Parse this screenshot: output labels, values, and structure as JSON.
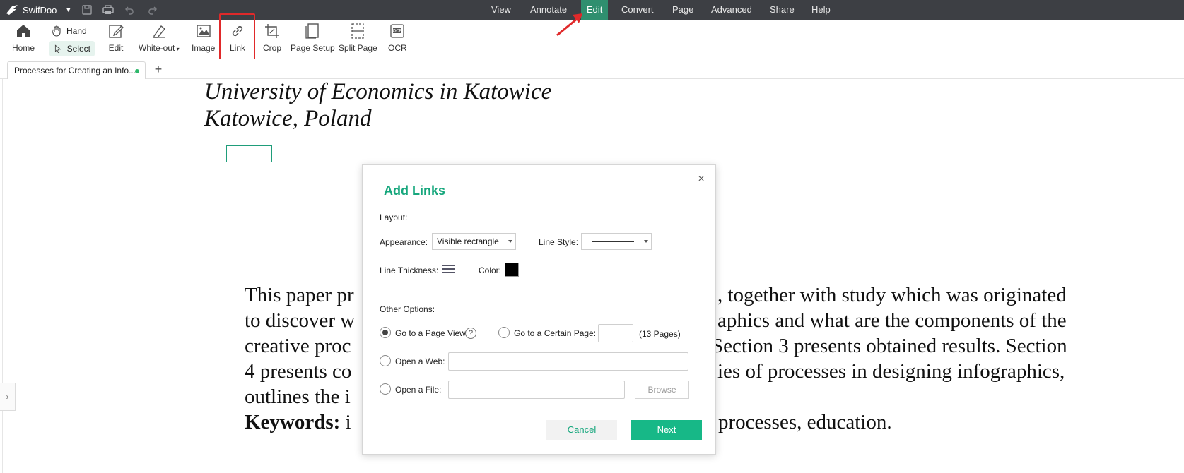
{
  "app": {
    "name": "SwifDoo"
  },
  "menu": {
    "items": [
      "View",
      "Annotate",
      "Edit",
      "Convert",
      "Page",
      "Advanced",
      "Share",
      "Help"
    ],
    "active": "Edit"
  },
  "toolbar": {
    "home": "Home",
    "hand": "Hand",
    "select": "Select",
    "edit": "Edit",
    "whiteout": "White-out",
    "image": "Image",
    "link": "Link",
    "crop": "Crop",
    "page_setup": "Page Setup",
    "split_page": "Split Page",
    "ocr": "OCR"
  },
  "tabs": {
    "doc_tab": "Processes for Creating an Info...",
    "add": "+"
  },
  "document": {
    "line1": "University of Economics in Katowice",
    "line2": "Katowice, Poland",
    "para": {
      "l1a": "This paper pr",
      "l1b": ", together with study which was originated",
      "l2a": "to discover w",
      "l2b": "aphics and what are the components of the",
      "l3a": "creative proc",
      "l3b": "Section 3 presents obtained results. Section",
      "l4a": "4 presents co",
      "l4b": "ies of processes in designing infographics,",
      "l5a": "outlines the i",
      "kw_label": "Keywords:",
      "kw_a": " i",
      "kw_b": "processes, education."
    }
  },
  "dialog": {
    "title": "Add Links",
    "close": "×",
    "layout_label": "Layout:",
    "appearance_label": "Appearance:",
    "appearance_value": "Visible rectangle",
    "line_style_label": "Line Style:",
    "line_thickness_label": "Line Thickness:",
    "color_label": "Color:",
    "color_value": "#000000",
    "other_options_label": "Other Options:",
    "opt_page_view": "Go to a Page View",
    "help": "?",
    "opt_certain_page": "Go to a Certain Page:",
    "pages_count": "(13 Pages)",
    "opt_web": "Open a Web:",
    "opt_file": "Open a File:",
    "browse": "Browse",
    "cancel": "Cancel",
    "next": "Next"
  },
  "colors": {
    "accent": "#17b887",
    "highlight": "#e0292a",
    "menubar": "#3d3f44"
  }
}
